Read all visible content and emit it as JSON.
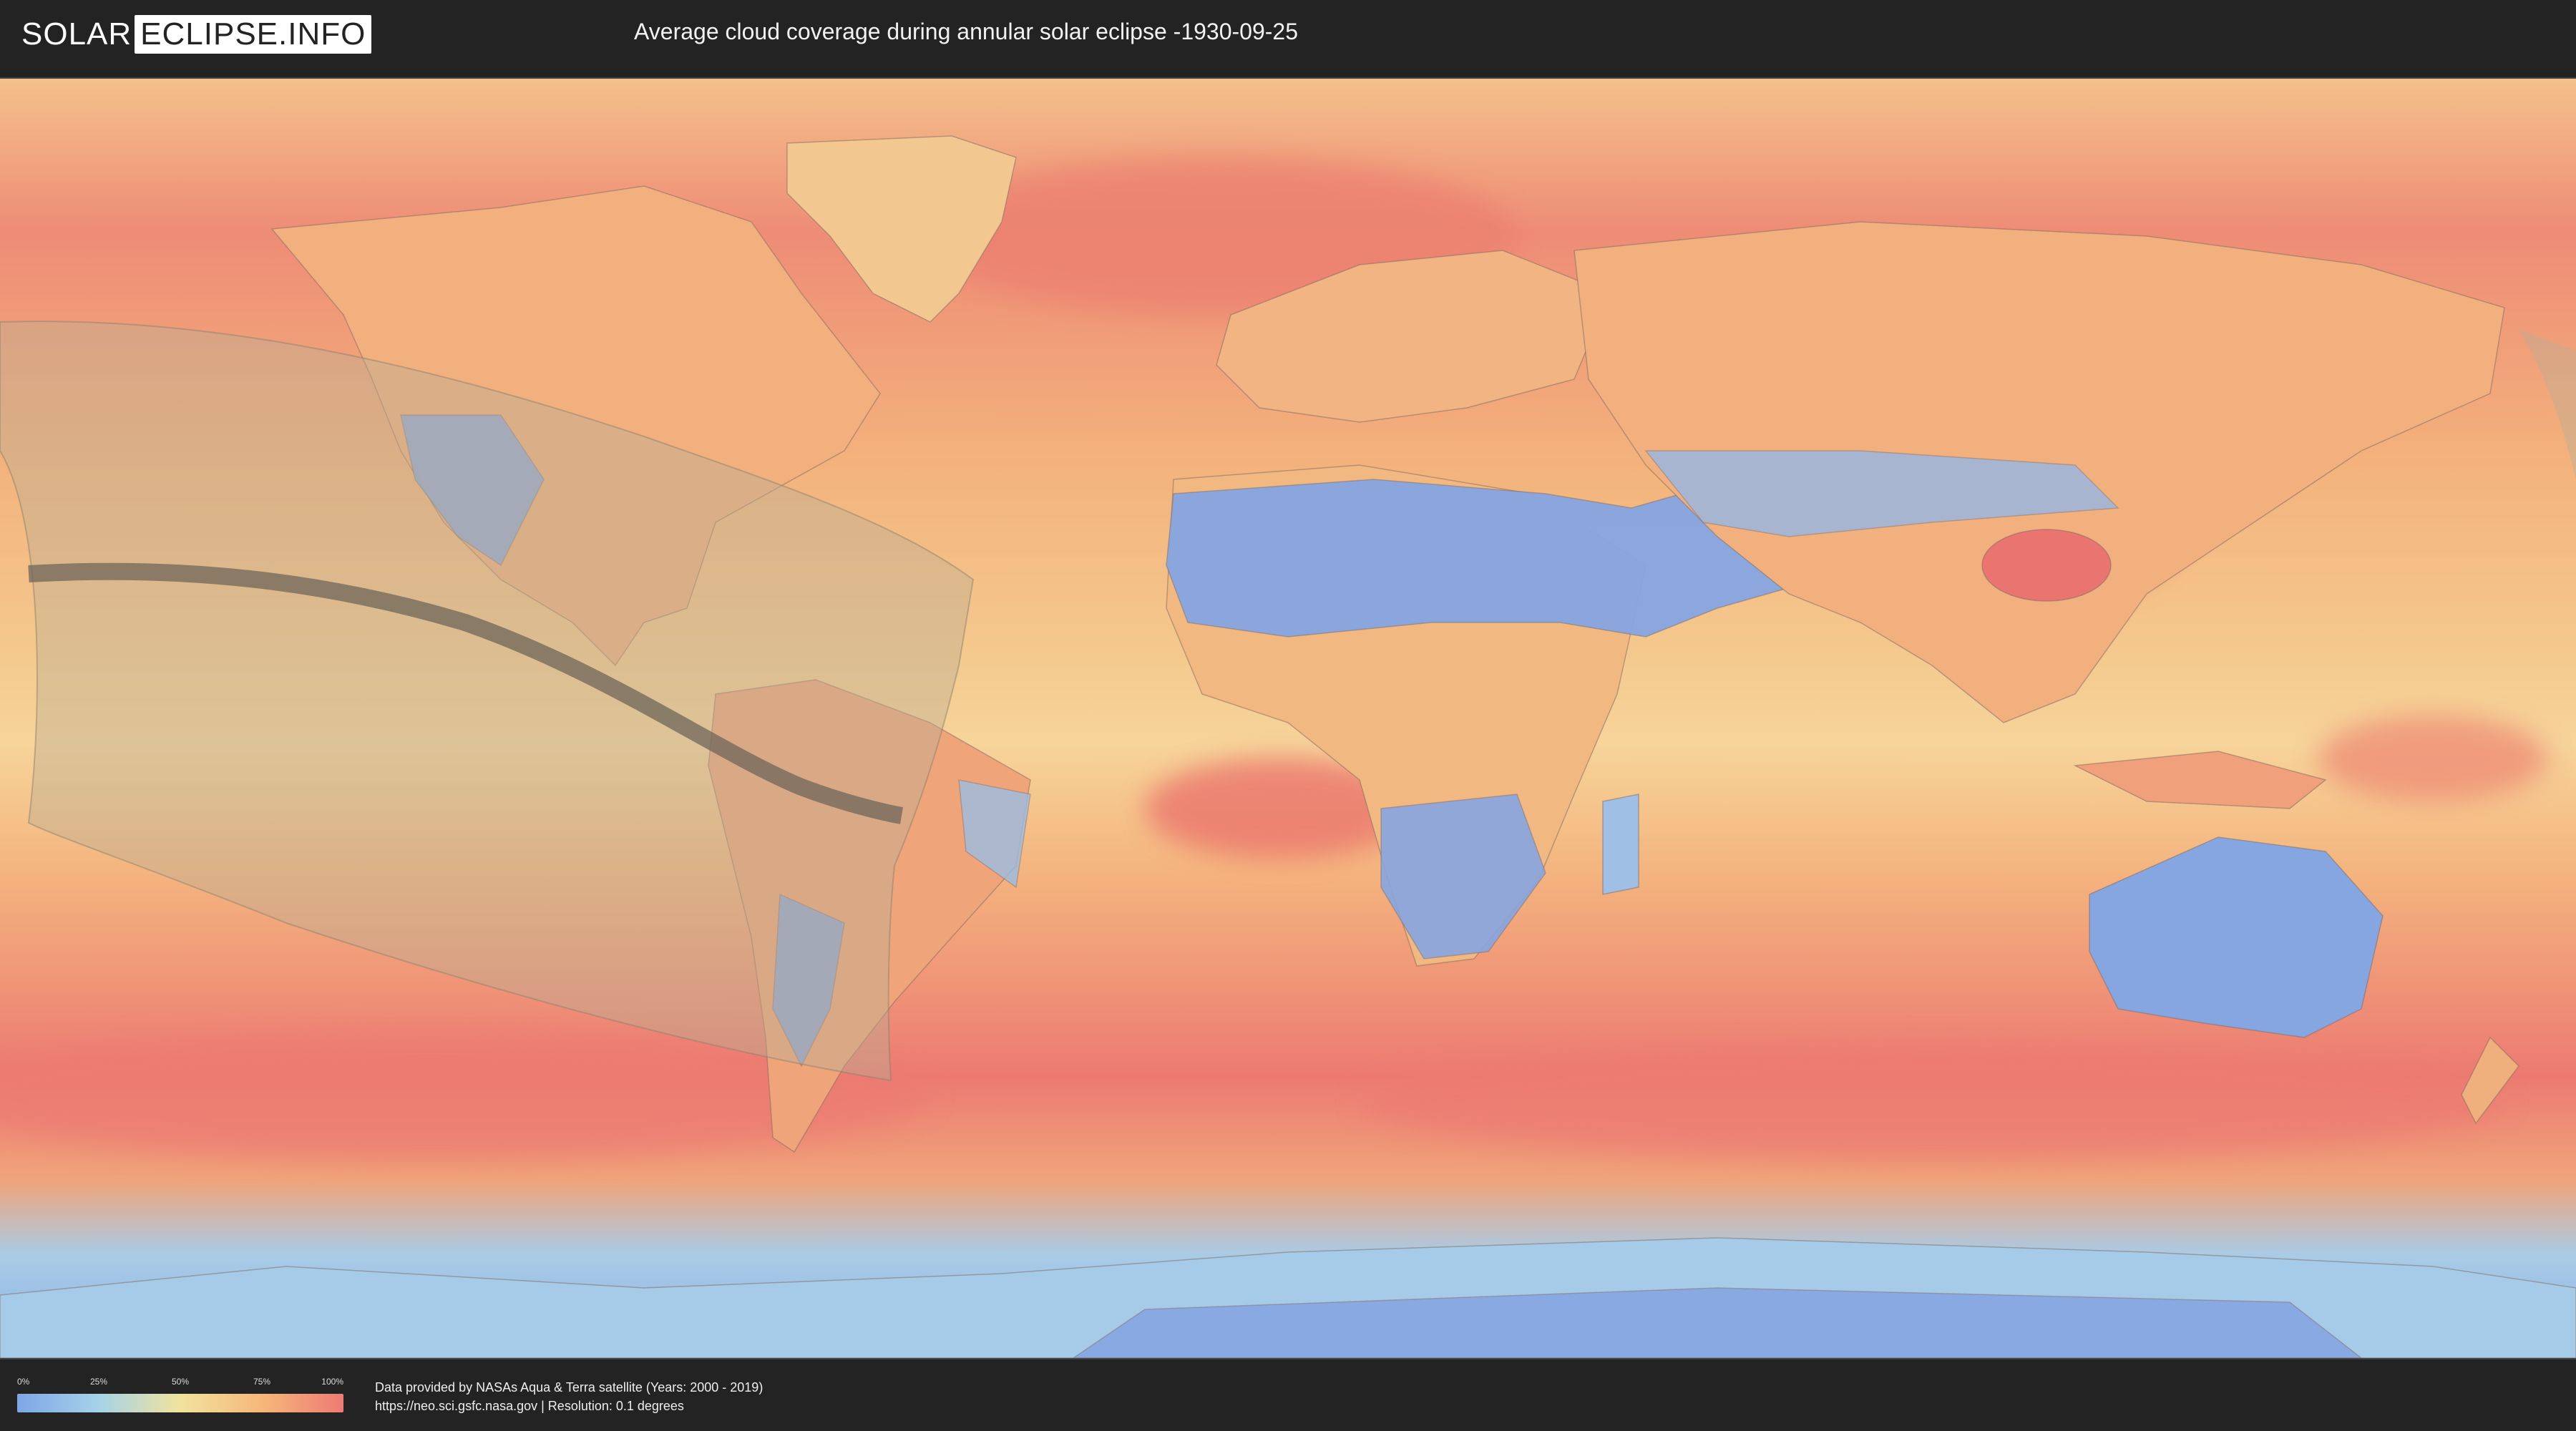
{
  "header": {
    "logo_left": "SOLAR",
    "logo_right": "ECLIPSE.INFO",
    "title": "Average cloud coverage during annular solar eclipse -1930-09-25"
  },
  "legend": {
    "ticks": [
      "0%",
      "25%",
      "50%",
      "75%",
      "100%"
    ],
    "color_low": "#7ea6e6",
    "color_mid": "#f1e39d",
    "color_high": "#ee7a74"
  },
  "footer": {
    "credit_line1": "Data provided by NASAs Aqua & Terra satellite (Years: 2000 - 2019)",
    "credit_line2": "https://neo.sci.gsfc.nasa.gov | Resolution: 0.1 degrees"
  },
  "map": {
    "projection": "equirectangular",
    "layers": [
      "cloud-coverage",
      "eclipse-visibility-zone",
      "annularity-path"
    ],
    "ocean_color": "#f3a472",
    "land_dry_color": "#86a6e2"
  }
}
